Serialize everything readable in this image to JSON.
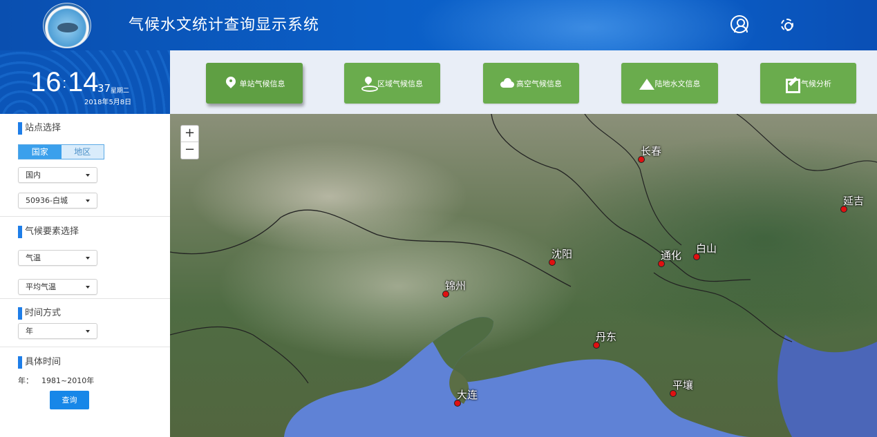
{
  "header": {
    "title": "气候水文统计查询显示系统"
  },
  "clock": {
    "hour": "16",
    "colon": ":",
    "minute": "14",
    "second": "37",
    "weekday": "星期二",
    "date": "2018年5月8日"
  },
  "toolbar": {
    "buttons": [
      {
        "label": "单站气候信息",
        "icon": "location-pin-icon"
      },
      {
        "label": "区域气候信息",
        "icon": "area-pin-icon"
      },
      {
        "label": "高空气候信息",
        "icon": "cloud-upload-icon"
      },
      {
        "label": "陆地水文信息",
        "icon": "mountain-icon"
      },
      {
        "label": "气候分析",
        "icon": "edit-icon"
      }
    ]
  },
  "sidebar": {
    "station": {
      "title": "站点选择",
      "tabs": [
        "国家",
        "地区"
      ],
      "scope_select": "国内",
      "station_select": "50936-白城"
    },
    "element": {
      "title": "气候要素选择",
      "element_select": "气温",
      "sub_select": "平均气温"
    },
    "time_mode": {
      "title": "时间方式",
      "select": "年"
    },
    "time": {
      "title": "具体时间",
      "label": "年：",
      "value": "1981~2010年"
    },
    "query_label": "查询"
  },
  "map": {
    "zoom_in": "+",
    "zoom_out": "−",
    "cities": [
      "长春",
      "延吉",
      "沈阳",
      "通化",
      "白山",
      "锦州",
      "丹东",
      "平壤",
      "大连"
    ]
  },
  "colors": {
    "header_blue": "#0b5fc7",
    "button_green": "#6aac4d",
    "accent_blue": "#1787e8",
    "city_marker": "#e01010"
  }
}
